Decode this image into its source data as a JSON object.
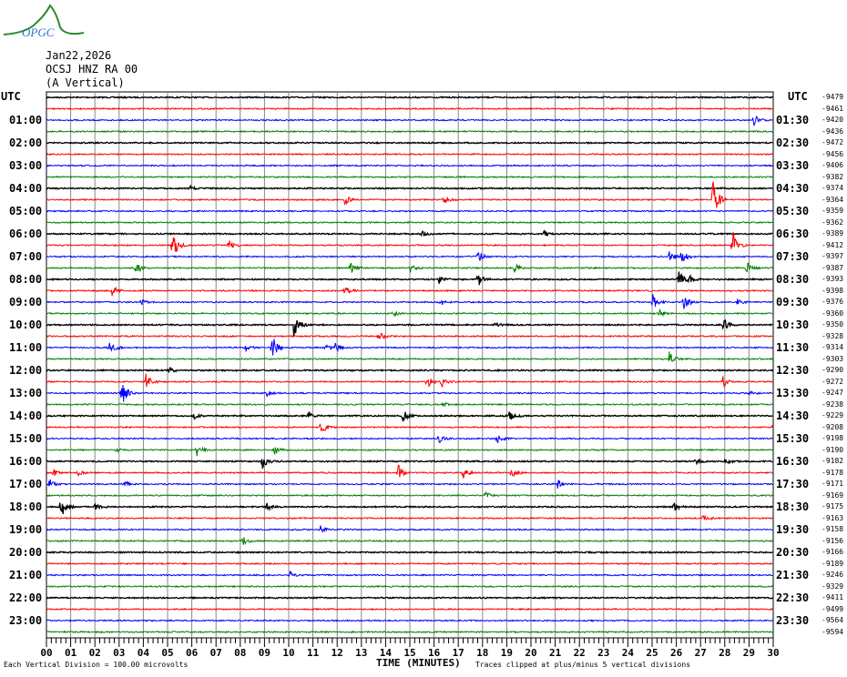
{
  "logo_text": "OPGC",
  "header": {
    "date": "Jan22,2026",
    "station": "OCSJ HNZ RA 00",
    "component": "(A Vertical)"
  },
  "left_utc": "UTC",
  "right_utc": "UTC",
  "left_labels": [
    "01:00",
    "02:00",
    "03:00",
    "04:00",
    "05:00",
    "06:00",
    "07:00",
    "08:00",
    "09:00",
    "10:00",
    "11:00",
    "12:00",
    "13:00",
    "14:00",
    "15:00",
    "16:00",
    "17:00",
    "18:00",
    "19:00",
    "20:00",
    "21:00",
    "22:00",
    "23:00"
  ],
  "right_labels": [
    "01:30",
    "02:30",
    "03:30",
    "04:30",
    "05:30",
    "06:30",
    "07:30",
    "08:30",
    "09:30",
    "10:30",
    "11:30",
    "12:30",
    "13:30",
    "14:30",
    "15:30",
    "16:30",
    "17:30",
    "18:30",
    "19:30",
    "20:30",
    "21:30",
    "22:30",
    "23:30"
  ],
  "offsets": [
    "-9479",
    "-9461",
    "-9420",
    "-9436",
    "-9472",
    "-9456",
    "-9406",
    "-9382",
    "-9374",
    "-9364",
    "-9359",
    "-9362",
    "-9389",
    "-9412",
    "-9397",
    "-9387",
    "-9393",
    "-9398",
    "-9376",
    "-9360",
    "-9350",
    "-9328",
    "-9314",
    "-9303",
    "-9290",
    "-9272",
    "-9247",
    "-9238",
    "-9229",
    "-9208",
    "-9198",
    "-9190",
    "-9182",
    "-9178",
    "-9171",
    "-9169",
    "-9175",
    "-9163",
    "-9158",
    "-9156",
    "-9166",
    "-9189",
    "-9246",
    "-9329",
    "-9411",
    "-9499",
    "-9564",
    "-9594"
  ],
  "footer": {
    "scale": "Each Vertical Division =  100.00 microvolts",
    "xlabel": "TIME (MINUTES)",
    "clip": "Traces clipped at plus/minus 5 vertical divisions"
  },
  "chart_data": {
    "type": "line",
    "title": "Jan22,2026 OCSJ HNZ RA 00 (A Vertical)",
    "xlabel": "TIME (MINUTES)",
    "xlim": [
      0,
      30
    ],
    "x_ticks": [
      "00",
      "01",
      "02",
      "03",
      "04",
      "05",
      "06",
      "07",
      "08",
      "09",
      "10",
      "11",
      "12",
      "13",
      "14",
      "15",
      "16",
      "17",
      "18",
      "19",
      "20",
      "21",
      "22",
      "23",
      "24",
      "25",
      "26",
      "27",
      "28",
      "29",
      "30"
    ],
    "trace_count": 48,
    "trace_minutes": 30,
    "colors": [
      "#000000",
      "#ff0000",
      "#0000ff",
      "#008000"
    ],
    "events": [
      {
        "trace": 2,
        "minute": 29.2,
        "amp": 1.2
      },
      {
        "trace": 8,
        "minute": 5.9,
        "amp": 0.5
      },
      {
        "trace": 9,
        "minute": 12.3,
        "amp": 1.0
      },
      {
        "trace": 9,
        "minute": 16.4,
        "amp": 1.0
      },
      {
        "trace": 9,
        "minute": 27.5,
        "amp": 5
      },
      {
        "trace": 12,
        "minute": 15.5,
        "amp": 0.5
      },
      {
        "trace": 12,
        "minute": 20.5,
        "amp": 0.6
      },
      {
        "trace": 13,
        "minute": 5.2,
        "amp": 3
      },
      {
        "trace": 13,
        "minute": 7.5,
        "amp": 1.2
      },
      {
        "trace": 13,
        "minute": 28.3,
        "amp": 3
      },
      {
        "trace": 14,
        "minute": 17.8,
        "amp": 1.2
      },
      {
        "trace": 14,
        "minute": 25.7,
        "amp": 1.2
      },
      {
        "trace": 14,
        "minute": 26.2,
        "amp": 1.6
      },
      {
        "trace": 15,
        "minute": 3.7,
        "amp": 1.2
      },
      {
        "trace": 15,
        "minute": 12.5,
        "amp": 1.2
      },
      {
        "trace": 15,
        "minute": 15,
        "amp": 0.9
      },
      {
        "trace": 15,
        "minute": 19.3,
        "amp": 0.9
      },
      {
        "trace": 15,
        "minute": 28.9,
        "amp": 1.4
      },
      {
        "trace": 16,
        "minute": 16.2,
        "amp": 0.8
      },
      {
        "trace": 16,
        "minute": 17.8,
        "amp": 1.5
      },
      {
        "trace": 16,
        "minute": 26.1,
        "amp": 1.5
      },
      {
        "trace": 16,
        "minute": 26.5,
        "amp": 0.8
      },
      {
        "trace": 17,
        "minute": 2.7,
        "amp": 1.0
      },
      {
        "trace": 17,
        "minute": 12.3,
        "amp": 1.0
      },
      {
        "trace": 18,
        "minute": 3.9,
        "amp": 0.6
      },
      {
        "trace": 18,
        "minute": 16.2,
        "amp": 1.0
      },
      {
        "trace": 18,
        "minute": 25,
        "amp": 1.5
      },
      {
        "trace": 18,
        "minute": 26.3,
        "amp": 1.5
      },
      {
        "trace": 18,
        "minute": 28.5,
        "amp": 0.8
      },
      {
        "trace": 19,
        "minute": 14.3,
        "amp": 0.5
      },
      {
        "trace": 19,
        "minute": 25.3,
        "amp": 0.6
      },
      {
        "trace": 20,
        "minute": 10.2,
        "amp": 2.5
      },
      {
        "trace": 20,
        "minute": 18.5,
        "amp": 0.5
      },
      {
        "trace": 20,
        "minute": 27.9,
        "amp": 1.4
      },
      {
        "trace": 21,
        "minute": 13.7,
        "amp": 1.2
      },
      {
        "trace": 22,
        "minute": 2.6,
        "amp": 1.5
      },
      {
        "trace": 22,
        "minute": 8.2,
        "amp": 0.8
      },
      {
        "trace": 22,
        "minute": 9.3,
        "amp": 2.5
      },
      {
        "trace": 22,
        "minute": 11.5,
        "amp": 0.8
      },
      {
        "trace": 22,
        "minute": 11.9,
        "amp": 1.0
      },
      {
        "trace": 23,
        "minute": 25.7,
        "amp": 1.4
      },
      {
        "trace": 24,
        "minute": 5.1,
        "amp": 0.5
      },
      {
        "trace": 25,
        "minute": 4.1,
        "amp": 1.6
      },
      {
        "trace": 25,
        "minute": 15.7,
        "amp": 1.2
      },
      {
        "trace": 25,
        "minute": 16.3,
        "amp": 1.2
      },
      {
        "trace": 25,
        "minute": 27.9,
        "amp": 1.2
      },
      {
        "trace": 26,
        "minute": 3.1,
        "amp": 2.5
      },
      {
        "trace": 26,
        "minute": 9.1,
        "amp": 0.6
      },
      {
        "trace": 26,
        "minute": 29,
        "amp": 0.8
      },
      {
        "trace": 27,
        "minute": 16.3,
        "amp": 0.6
      },
      {
        "trace": 28,
        "minute": 6.1,
        "amp": 0.6
      },
      {
        "trace": 28,
        "minute": 10.8,
        "amp": 0.8
      },
      {
        "trace": 28,
        "minute": 14.7,
        "amp": 1.2
      },
      {
        "trace": 28,
        "minute": 19.1,
        "amp": 1.4
      },
      {
        "trace": 29,
        "minute": 11.3,
        "amp": 1.6
      },
      {
        "trace": 29,
        "minute": 30,
        "amp": 1.5
      },
      {
        "trace": 30,
        "minute": 16.2,
        "amp": 0.8
      },
      {
        "trace": 30,
        "minute": 18.6,
        "amp": 0.8
      },
      {
        "trace": 31,
        "minute": 2.9,
        "amp": 0.4
      },
      {
        "trace": 31,
        "minute": 6.2,
        "amp": 1.2
      },
      {
        "trace": 31,
        "minute": 9.4,
        "amp": 1.0
      },
      {
        "trace": 32,
        "minute": 8.9,
        "amp": 1.4
      },
      {
        "trace": 32,
        "minute": 26.8,
        "amp": 0.6
      },
      {
        "trace": 32,
        "minute": 28,
        "amp": 0.6
      },
      {
        "trace": 33,
        "minute": 0.3,
        "amp": 0.8
      },
      {
        "trace": 33,
        "minute": 1.3,
        "amp": 0.5
      },
      {
        "trace": 33,
        "minute": 14.5,
        "amp": 1.6
      },
      {
        "trace": 33,
        "minute": 17.2,
        "amp": 1.0
      },
      {
        "trace": 33,
        "minute": 19.2,
        "amp": 1.2
      },
      {
        "trace": 34,
        "minute": 0.1,
        "amp": 1.0
      },
      {
        "trace": 34,
        "minute": 3.2,
        "amp": 0.6
      },
      {
        "trace": 34,
        "minute": 21.1,
        "amp": 0.8
      },
      {
        "trace": 35,
        "minute": 18.1,
        "amp": 0.6
      },
      {
        "trace": 36,
        "minute": 0.6,
        "amp": 2.0
      },
      {
        "trace": 36,
        "minute": 2.0,
        "amp": 0.5
      },
      {
        "trace": 36,
        "minute": 9.1,
        "amp": 0.8
      },
      {
        "trace": 36,
        "minute": 25.9,
        "amp": 0.8
      },
      {
        "trace": 37,
        "minute": 27.1,
        "amp": 1.0
      },
      {
        "trace": 38,
        "minute": 11.3,
        "amp": 0.8
      },
      {
        "trace": 39,
        "minute": 8.1,
        "amp": 0.8
      },
      {
        "trace": 42,
        "minute": 10.0,
        "amp": 0.8
      }
    ]
  }
}
